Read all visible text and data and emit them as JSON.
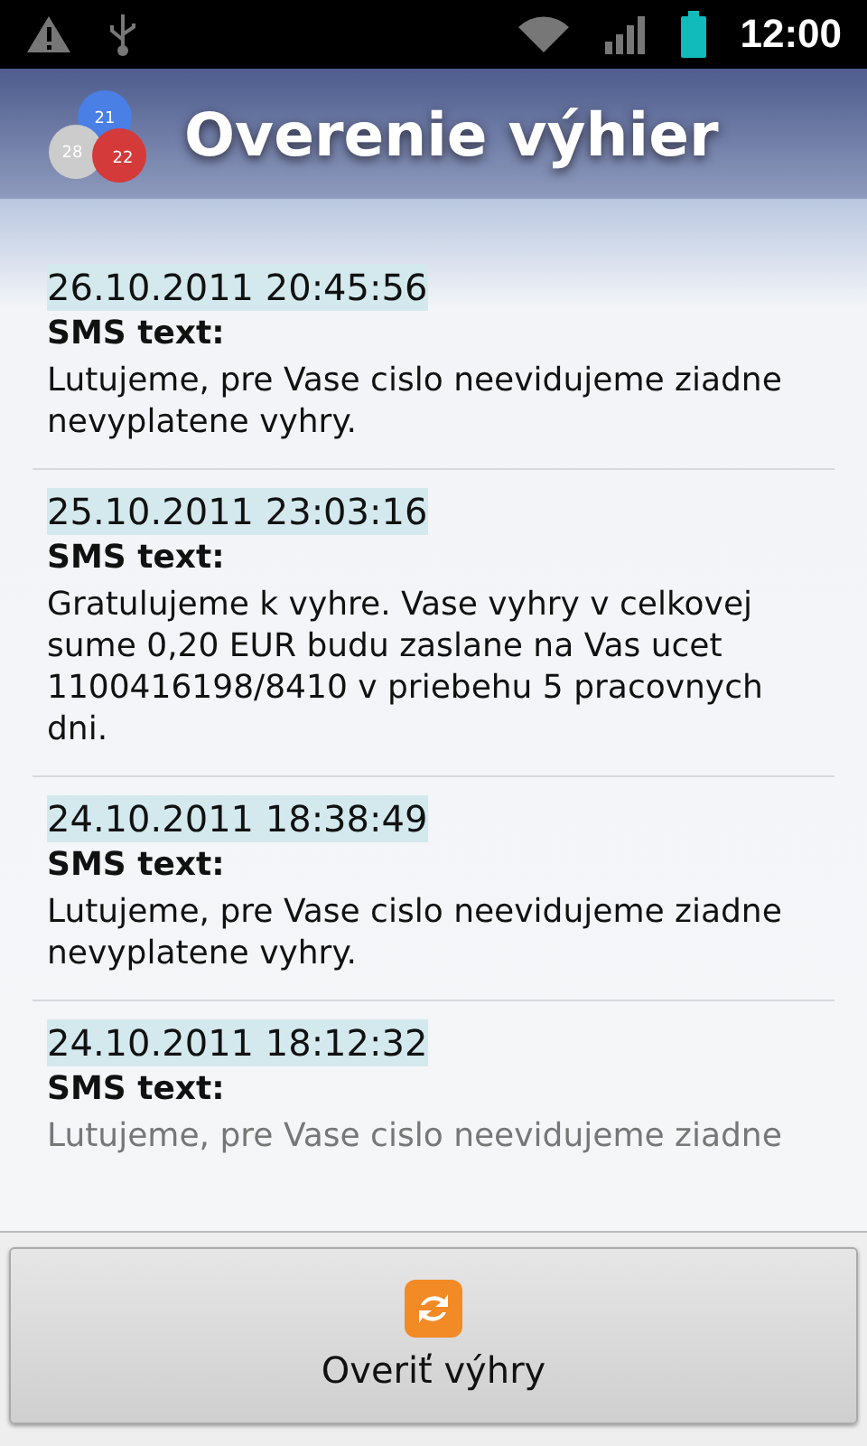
{
  "status_bar": {
    "time": "12:00"
  },
  "header": {
    "title": "Overenie výhier",
    "logo_balls": [
      "21",
      "28",
      "22"
    ]
  },
  "messages": [
    {
      "datetime": "26.10.2011 20:45:56",
      "label": "SMS text:",
      "text": "Lutujeme, pre Vase cislo neevidujeme ziadne nevyplatene vyhry."
    },
    {
      "datetime": "25.10.2011 23:03:16",
      "label": "SMS text:",
      "text": "Gratulujeme k vyhre. Vase vyhry v celkovej sume 0,20 EUR budu zaslane na Vas ucet 1100416198/8410 v priebehu 5 pracovnych dni."
    },
    {
      "datetime": "24.10.2011 18:38:49",
      "label": "SMS text:",
      "text": "Lutujeme, pre Vase cislo neevidujeme ziadne nevyplatene vyhry."
    },
    {
      "datetime": "24.10.2011 18:12:32",
      "label": "SMS text:",
      "text": "Lutujeme, pre Vase cislo neevidujeme ziadne"
    }
  ],
  "button": {
    "label": "Overiť výhry"
  }
}
